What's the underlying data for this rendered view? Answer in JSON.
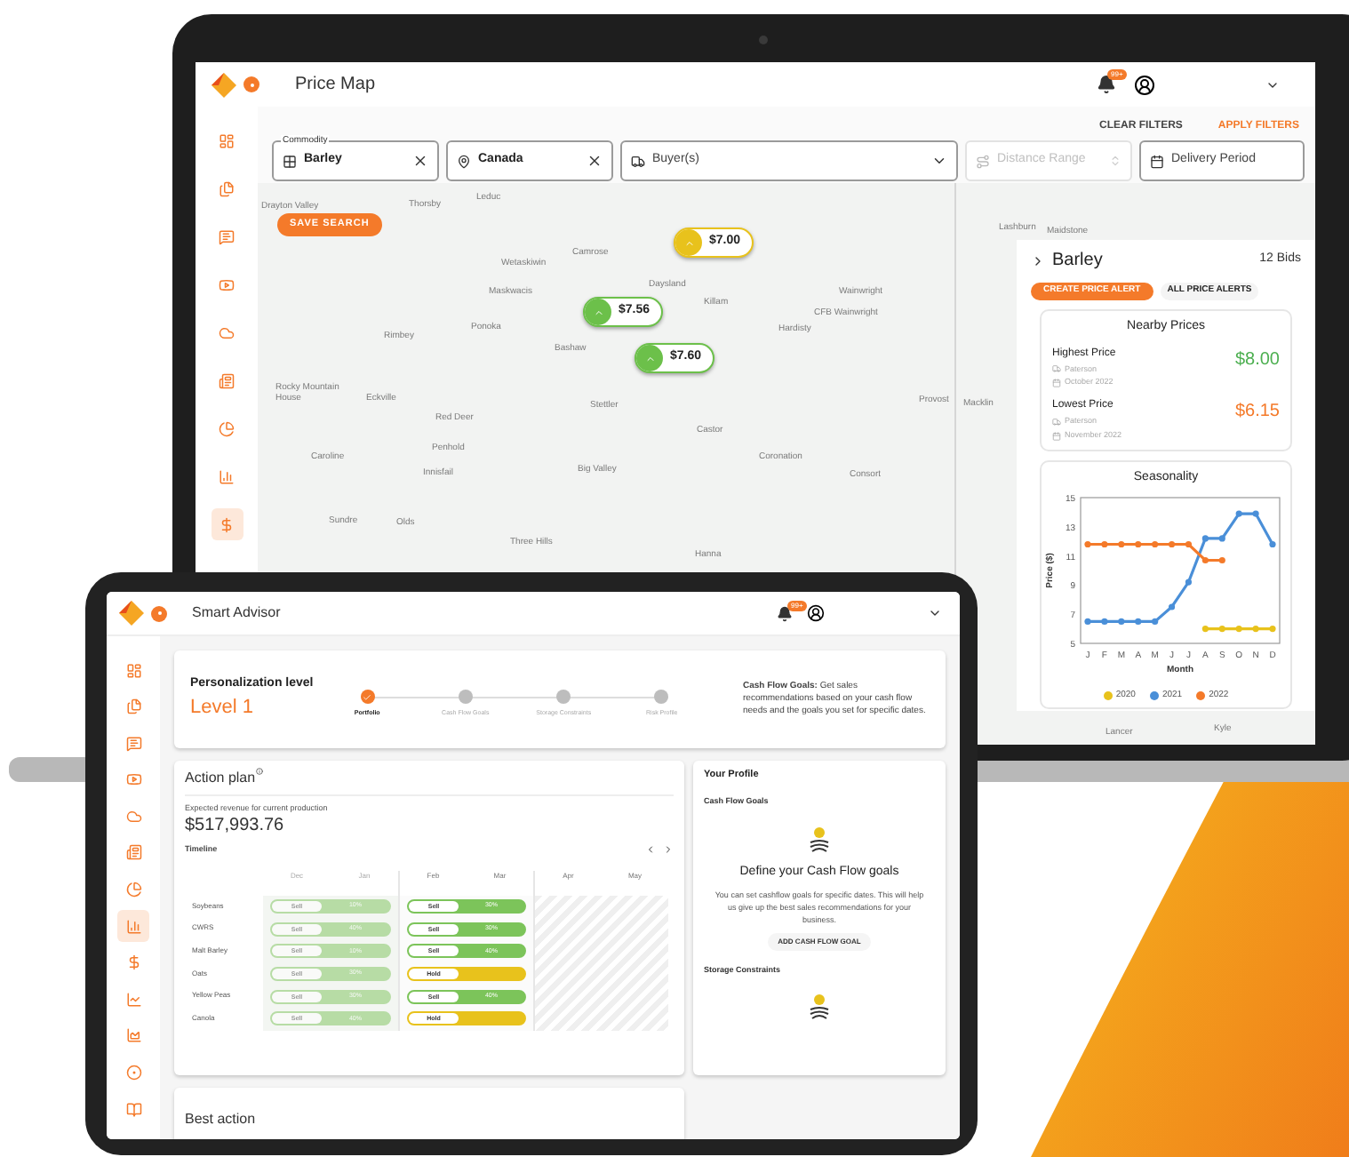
{
  "laptop": {
    "header": {
      "title": "Price Map",
      "badge": "99+"
    },
    "sidebar": {
      "items": [
        {
          "selected": false
        },
        {
          "selected": false
        },
        {
          "selected": false
        },
        {
          "selected": false
        },
        {
          "selected": false
        },
        {
          "selected": false
        },
        {
          "selected": false
        },
        {
          "selected": false
        },
        {
          "selected": true
        }
      ]
    },
    "filters": {
      "clear": "CLEAR FILTERS",
      "apply": "APPLY FILTERS",
      "fields": [
        {
          "kind": "commodity",
          "legend": "Commodity",
          "value": "Barley",
          "disabled": false
        },
        {
          "kind": "location",
          "value": "Canada",
          "disabled": false
        },
        {
          "kind": "buyer",
          "placeholder": "Buyer(s)",
          "disabled": false
        },
        {
          "kind": "distance",
          "placeholder": "Distance Range",
          "disabled": true
        },
        {
          "kind": "period",
          "placeholder": "Delivery Period",
          "disabled": false
        }
      ]
    },
    "map": {
      "save_button": "SAVE SEARCH",
      "labels": [
        "Drayton Valley",
        "Thorsby",
        "Leduc",
        "Wetaskiwin",
        "Camrose",
        "Maskwacis",
        "Ponoka",
        "Rimbey",
        "Daysland",
        "Killam",
        "Wainwright",
        "CFB Wainwright",
        "Hardisty",
        "Bashaw",
        "Rocky Mountain House",
        "Eckville",
        "Red Deer",
        "Penhold",
        "Innisfail",
        "Caroline",
        "Stettler",
        "Castor",
        "Coronation",
        "Consort",
        "Provost",
        "Macklin",
        "Lashburn",
        "Maidstone",
        "Big Valley",
        "Sundre",
        "Olds",
        "Three Hills",
        "Hanna",
        "Lancer",
        "Kyle"
      ],
      "pins": [
        {
          "price": "$7.00",
          "color": "#e8c21c"
        },
        {
          "price": "$7.56",
          "color": "#6cc04a"
        },
        {
          "price": "$7.60",
          "color": "#6cc04a"
        }
      ]
    },
    "panel": {
      "commodity": "Barley",
      "bids": "12 Bids",
      "create_alert": "CREATE PRICE ALERT",
      "all_alerts": "ALL PRICE ALERTS",
      "nearby": {
        "title": "Nearby Prices",
        "items": [
          {
            "kind": "high",
            "label": "Highest Price",
            "buyer": "Paterson",
            "date": "October 2022",
            "price": "$8.00"
          },
          {
            "kind": "low",
            "label": "Lowest Price",
            "buyer": "Paterson",
            "date": "November 2022",
            "price": "$6.15"
          }
        ]
      },
      "seasonality": {
        "title": "Seasonality",
        "chart_data": {
          "type": "line",
          "legend": "bottom",
          "xlabel": "Month",
          "ylabel": "Price ($)",
          "categories": [
            "J",
            "F",
            "M",
            "A",
            "M",
            "J",
            "J",
            "A",
            "S",
            "O",
            "N",
            "D"
          ],
          "ylim": [
            5,
            15
          ],
          "yticks": [
            5,
            7,
            9,
            11,
            13,
            15
          ],
          "series": [
            {
              "name": "2020",
              "color": "#e8c21c",
              "marker": "circle",
              "values": [
                null,
                null,
                null,
                null,
                null,
                null,
                null,
                6,
                6,
                6,
                6,
                6
              ]
            },
            {
              "name": "2021",
              "color": "#4a8fd8",
              "marker": "circle",
              "values": [
                6.5,
                6.5,
                6.5,
                6.5,
                6.5,
                7.5,
                9.2,
                12.2,
                12.2,
                13.9,
                13.9,
                11.8
              ]
            },
            {
              "name": "2022",
              "color": "#f47a2a",
              "marker": "circle",
              "values": [
                11.8,
                11.8,
                11.8,
                11.8,
                11.8,
                11.8,
                11.8,
                10.7,
                10.7,
                null,
                null,
                null
              ]
            }
          ]
        }
      }
    }
  },
  "tablet": {
    "header": {
      "title": "Smart Advisor",
      "badge": "99+"
    },
    "sidebar": {
      "items": [
        {
          "selected": false
        },
        {
          "selected": false
        },
        {
          "selected": false
        },
        {
          "selected": false
        },
        {
          "selected": false
        },
        {
          "selected": false
        },
        {
          "selected": false
        },
        {
          "selected": true
        },
        {
          "selected": false
        },
        {
          "selected": false
        },
        {
          "selected": false
        },
        {
          "selected": false
        },
        {
          "selected": false
        }
      ]
    },
    "personalization": {
      "title": "Personalization level",
      "level": "Level 1",
      "steps": [
        {
          "label": "Portfolio",
          "done": true
        },
        {
          "label": "Cash Flow Goals",
          "done": false
        },
        {
          "label": "Storage Constraints",
          "done": false
        },
        {
          "label": "Risk Profile",
          "done": false
        }
      ],
      "note": "**Cash Flow Goals:** Get sales recommendations based on your cash flow needs and the goals you set for specific dates."
    },
    "action_plan": {
      "title": "Action plan",
      "revenue_label": "Expected revenue for current production",
      "revenue": "$517,993.76",
      "timeline": {
        "title": "Timeline",
        "months": [
          "Dec",
          "Jan",
          "Feb",
          "Mar",
          "Apr",
          "May"
        ],
        "periods": [
          {
            "past": true
          },
          {
            "past": false
          },
          {
            "past": false
          }
        ],
        "rows": [
          {
            "crop": "Soybeans",
            "cells": [
              {
                "kind": "sell",
                "action": "Sell",
                "share": "10%"
              },
              {
                "kind": "sell",
                "action": "Sell",
                "share": "30%"
              }
            ]
          },
          {
            "crop": "CWRS",
            "cells": [
              {
                "kind": "sell",
                "action": "Sell",
                "share": "40%"
              },
              {
                "kind": "sell",
                "action": "Sell",
                "share": "30%"
              }
            ]
          },
          {
            "crop": "Malt Barley",
            "cells": [
              {
                "kind": "sell",
                "action": "Sell",
                "share": "10%"
              },
              {
                "kind": "sell",
                "action": "Sell",
                "share": "40%"
              }
            ]
          },
          {
            "crop": "Oats",
            "cells": [
              {
                "kind": "sell",
                "action": "Sell",
                "share": "30%"
              },
              {
                "kind": "hold",
                "action": "Hold"
              }
            ]
          },
          {
            "crop": "Yellow Peas",
            "cells": [
              {
                "kind": "sell",
                "action": "Sell",
                "share": "30%"
              },
              {
                "kind": "sell",
                "action": "Sell",
                "share": "40%"
              }
            ]
          },
          {
            "crop": "Canola",
            "cells": [
              {
                "kind": "sell",
                "action": "Sell",
                "share": "40%"
              },
              {
                "kind": "hold",
                "action": "Hold"
              }
            ]
          }
        ]
      }
    },
    "best_action": {
      "title": "Best action"
    },
    "profile": {
      "title": "Your Profile",
      "sections": [
        {
          "title": "Cash Flow Goals",
          "heading": "Define your Cash Flow goals",
          "text": "You can set cashflow goals for specific dates. This will help us give up the best sales recommendations for your business.",
          "button": "ADD CASH FLOW GOAL"
        },
        {
          "title": "Storage Constraints"
        }
      ]
    }
  }
}
